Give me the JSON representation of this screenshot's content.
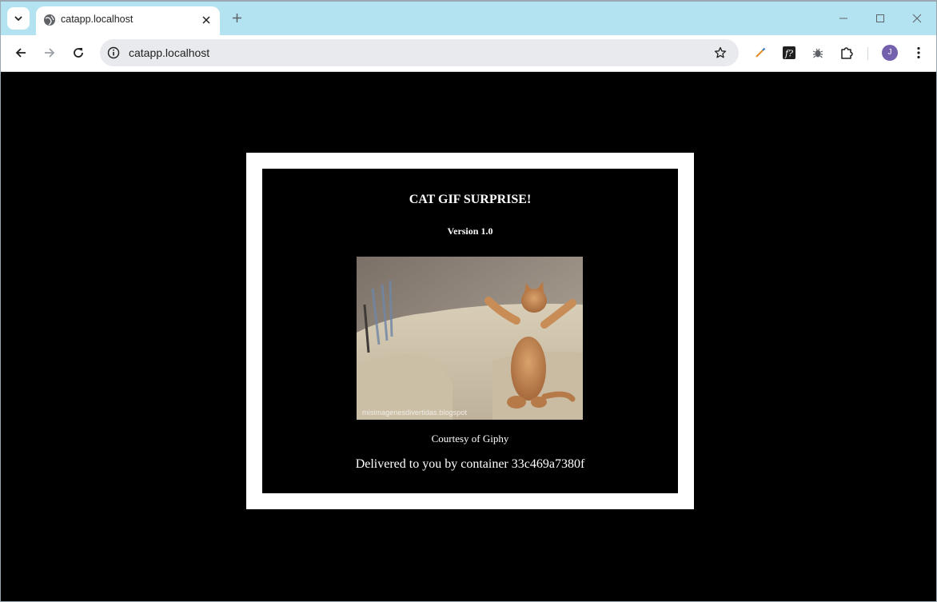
{
  "browser": {
    "tab": {
      "title": "catapp.localhost"
    },
    "omnibox": {
      "url": "catapp.localhost"
    },
    "profile": {
      "initial": "J",
      "color": "#7460ac"
    },
    "icons": [
      "tab-search-icon",
      "globe-icon",
      "close-icon",
      "plus-icon",
      "minimize-icon",
      "maximize-icon",
      "close-window-icon",
      "back-arrow-icon",
      "forward-arrow-icon",
      "reload-icon",
      "info-icon",
      "star-icon",
      "eyedropper-icon",
      "font-icon",
      "bug-icon",
      "puzzle-icon",
      "kebab-menu-icon"
    ],
    "colors": {
      "tabstrip": "#b3e3f1",
      "omnibox": "#e8eaed"
    }
  },
  "page": {
    "title": "CAT GIF SURPRISE!",
    "version": "Version 1.0",
    "gif_watermark": "misimagenesdivertidas.blogspot",
    "courtesy": "Courtesy of Giphy",
    "delivered": "Delivered to you by container 33c469a7380f"
  }
}
